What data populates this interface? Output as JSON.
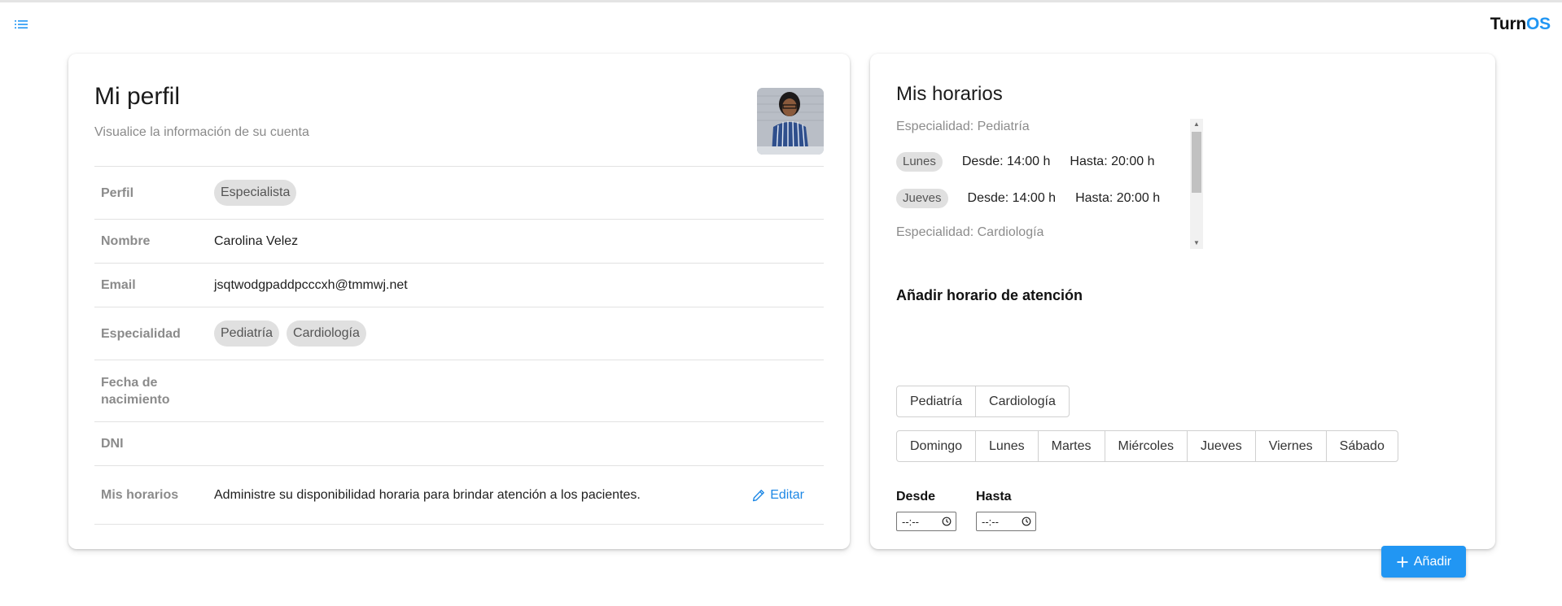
{
  "app": {
    "brand_prefix": "Turn",
    "brand_suffix": "OS"
  },
  "profile": {
    "title": "Mi perfil",
    "subtitle": "Visualice la información de su cuenta",
    "rows": {
      "perfil": {
        "label": "Perfil",
        "chip": "Especialista"
      },
      "nombre": {
        "label": "Nombre",
        "value": "Carolina Velez"
      },
      "email": {
        "label": "Email",
        "value": "jsqtwodgpaddpcccxh@tmmwj.net"
      },
      "especialidad": {
        "label": "Especialidad",
        "chips": [
          "Pediatría",
          "Cardiología"
        ]
      },
      "fecha": {
        "label_line1": "Fecha de",
        "label_line2": "nacimiento",
        "value": ""
      },
      "dni": {
        "label": "DNI",
        "value": ""
      },
      "horarios": {
        "label": "Mis horarios",
        "value": "Administre su disponibilidad horaria para brindar atención a los pacientes.",
        "edit_label": "Editar"
      }
    }
  },
  "hours": {
    "title": "Mis horarios",
    "specialties": [
      {
        "label": "Especialidad: Pediatría",
        "days": [
          {
            "day": "Lunes",
            "desde": "Desde: 14:00 h",
            "hasta": "Hasta: 20:00 h"
          },
          {
            "day": "Jueves",
            "desde": "Desde: 14:00 h",
            "hasta": "Hasta: 20:00 h"
          }
        ]
      },
      {
        "label": "Especialidad: Cardiología"
      }
    ],
    "add_section": {
      "title": "Añadir horario de atención",
      "specialty_options": [
        "Pediatría",
        "Cardiología"
      ],
      "day_options": [
        "Domingo",
        "Lunes",
        "Martes",
        "Miércoles",
        "Jueves",
        "Viernes",
        "Sábado"
      ],
      "desde_label": "Desde",
      "hasta_label": "Hasta",
      "time_placeholder": "--:--",
      "add_button": "Añadir"
    }
  },
  "colors": {
    "accent": "#2196f3",
    "chip_bg": "#e0e0e0",
    "muted_text": "#8b8b8b"
  },
  "icons": [
    "menu-list-icon",
    "pencil-icon",
    "plus-icon",
    "clock-icon",
    "scroll-up-arrow-icon",
    "scroll-down-arrow-icon"
  ]
}
